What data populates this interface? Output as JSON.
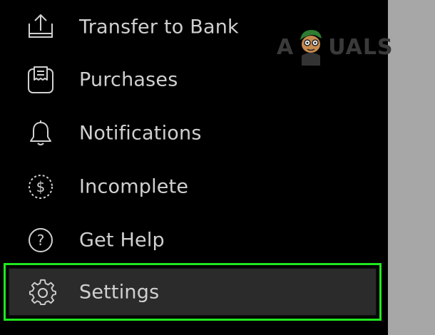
{
  "menu": {
    "items": [
      {
        "label": "Transfer to Bank",
        "icon": "bank-transfer-icon"
      },
      {
        "label": "Purchases",
        "icon": "purchases-receipt-icon"
      },
      {
        "label": "Notifications",
        "icon": "bell-icon"
      },
      {
        "label": "Incomplete",
        "icon": "dollar-dashed-circle-icon"
      },
      {
        "label": "Get Help",
        "icon": "question-circle-icon"
      },
      {
        "label": "Settings",
        "icon": "gear-icon"
      }
    ],
    "highlighted_index": 5
  },
  "watermark": {
    "left": "A",
    "right": "UALS"
  },
  "colors": {
    "background": "#000000",
    "text": "#d0d0d0",
    "highlight_border": "#20e720",
    "selected_row": "#2b2b2b",
    "side_panel": "#a7a7a7"
  }
}
